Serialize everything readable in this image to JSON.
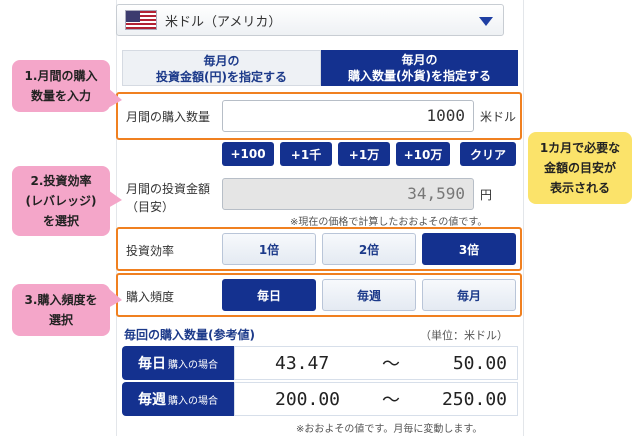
{
  "currency_select": {
    "label": "米ドル（アメリカ）"
  },
  "mode_tabs": [
    {
      "line1": "毎月の",
      "line2": "投資金額(円)を指定する",
      "selected": false
    },
    {
      "line1": "毎月の",
      "line2": "購入数量(外貨)を指定する",
      "selected": true
    }
  ],
  "quantity": {
    "label": "月間の購入数量",
    "value": "1000",
    "unit": "米ドル"
  },
  "quick_add": [
    "+100",
    "+1千",
    "+1万",
    "+10万",
    "クリア"
  ],
  "investment": {
    "label_line1": "月間の投資金額",
    "label_line2": "（目安）",
    "value": "34,590",
    "unit": "円",
    "note": "※現在の価格で計算したおおよその値です。"
  },
  "leverage": {
    "label": "投資効率",
    "options": [
      "1倍",
      "2倍",
      "3倍"
    ],
    "selected_index": 2
  },
  "frequency": {
    "label": "購入頻度",
    "options": [
      "毎日",
      "毎週",
      "毎月"
    ],
    "selected_index": 0
  },
  "reference": {
    "title": "毎回の購入数量(参考値)",
    "unit_note": "（単位：米ドル）",
    "rows": [
      {
        "big": "毎日",
        "small": "購入の場合",
        "min": "43.47",
        "sep": "〜",
        "max": "50.00"
      },
      {
        "big": "毎週",
        "small": "購入の場合",
        "min": "200.00",
        "sep": "〜",
        "max": "250.00"
      }
    ],
    "footnote": "※おおよその値です。月毎に変動します。"
  },
  "callouts": {
    "c1": {
      "line1": "1.月間の購入",
      "line2": "数量を入力"
    },
    "c2": {
      "line1": "2.投資効率",
      "line2": "(レバレッジ)",
      "line3": "を選択"
    },
    "c3": {
      "line1": "3.購入頻度を",
      "line2": "選択"
    },
    "c4": {
      "line1": "1カ月で必要な",
      "line2": "金額の目安が",
      "line3": "表示される"
    }
  },
  "colors": {
    "primary": "#14318f",
    "highlight": "#f08020",
    "callout_pink": "#f4a6c9",
    "callout_yellow": "#fbe36a"
  }
}
